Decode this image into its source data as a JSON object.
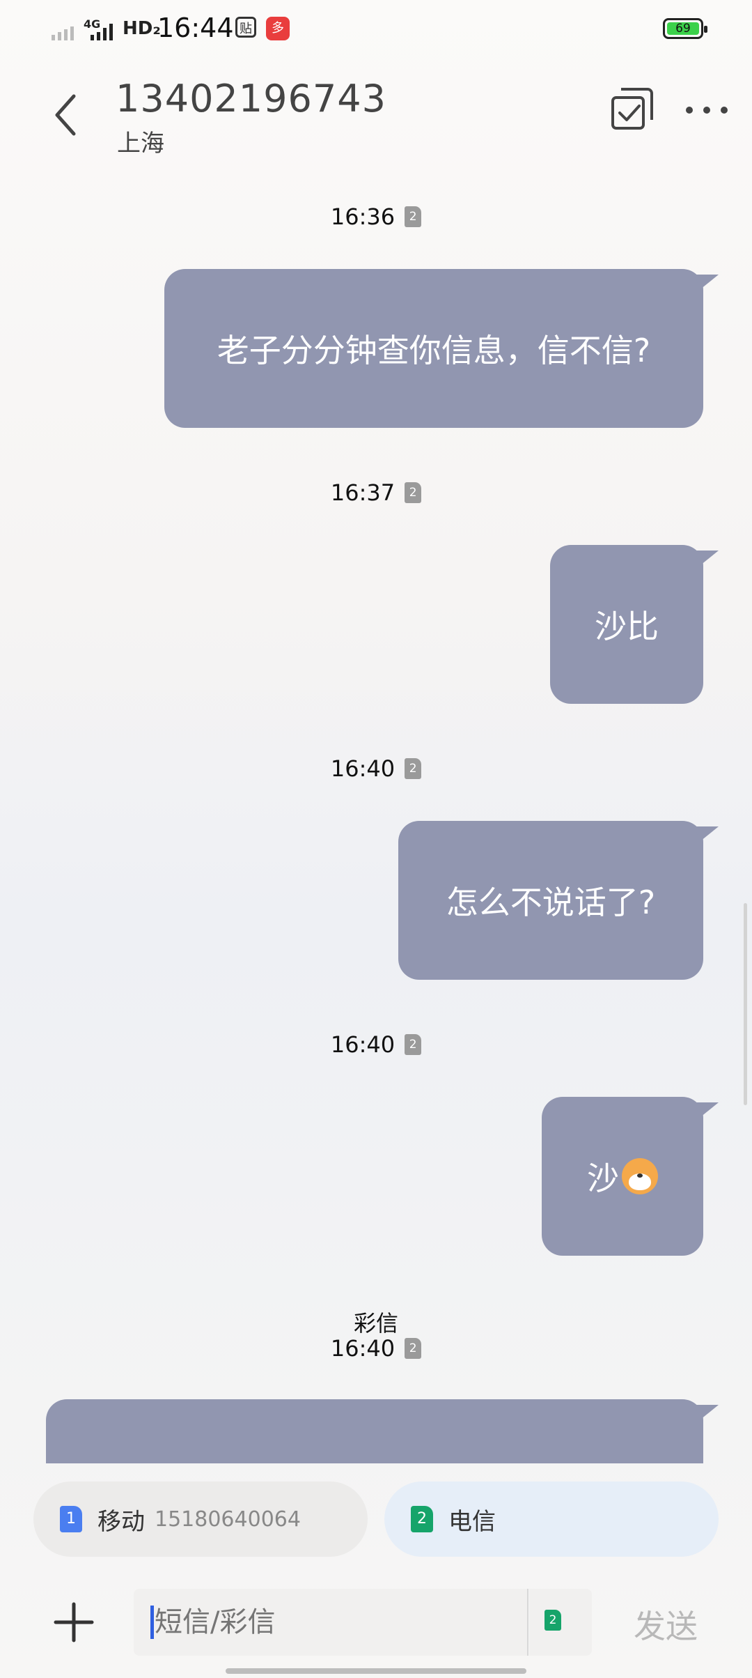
{
  "status_bar": {
    "network": "4G",
    "hd": "HD₂",
    "time": "16:44",
    "app1_icon": "tieba-icon",
    "app2_icon": "pinduoduo-icon",
    "battery": "69"
  },
  "header": {
    "title": "13402196743",
    "subtitle": "上海",
    "back_icon": "chevron-left-icon",
    "select_icon": "multi-select-icon",
    "more_icon": "more-icon"
  },
  "messages": [
    {
      "time": "16:36",
      "sim": "2",
      "text": "老子分分钟查你信息，信不信?"
    },
    {
      "time": "16:37",
      "sim": "2",
      "text": "沙比"
    },
    {
      "time": "16:40",
      "sim": "2",
      "text": "怎么不说话了?"
    },
    {
      "time": "16:40",
      "sim": "2",
      "text": "沙",
      "emoji": "dog-face-emoji"
    },
    {
      "label": "彩信",
      "time": "16:40",
      "sim": "2",
      "text": ""
    }
  ],
  "sim_cards": [
    {
      "slot": "1",
      "carrier": "移动",
      "number": "15180640064",
      "color": "#4a7ef0"
    },
    {
      "slot": "2",
      "carrier": "电信",
      "number": "",
      "color": "#16a46a"
    }
  ],
  "compose": {
    "placeholder": "短信/彩信",
    "sim": "2",
    "send_label": "发送",
    "add_icon": "plus-icon"
  },
  "colors": {
    "bubble": "#9196b0",
    "accent": "#2f5fe0"
  }
}
